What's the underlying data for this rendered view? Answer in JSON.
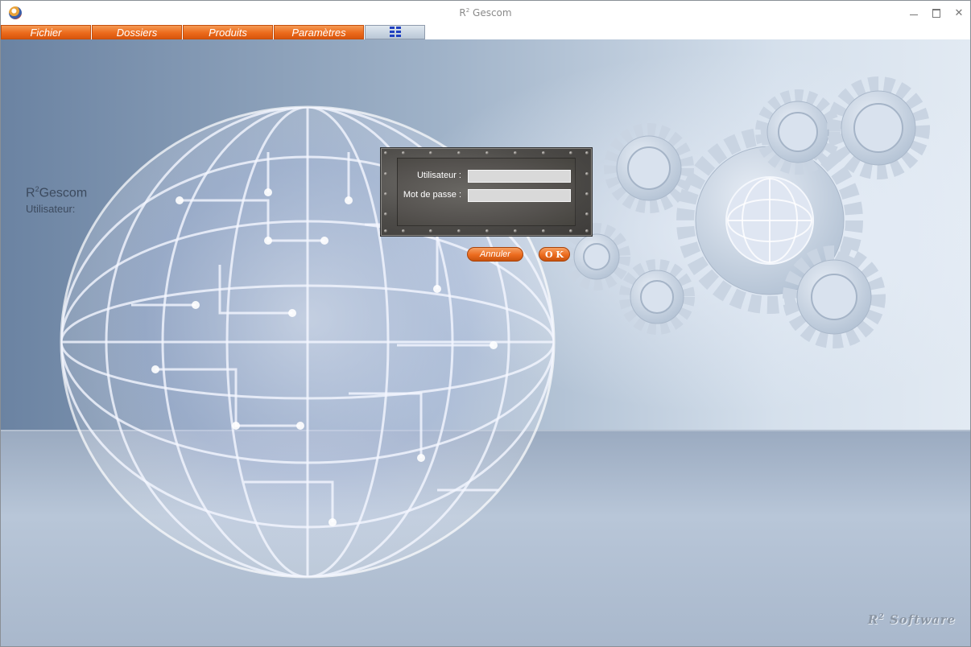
{
  "window": {
    "title_main": "R",
    "title_sup": "2",
    "title_rest": " Gescom",
    "minimize_symbol": "",
    "close_symbol": "✕"
  },
  "menu": {
    "items": [
      {
        "label": "Fichier"
      },
      {
        "label": "Dossiers"
      },
      {
        "label": "Produits"
      },
      {
        "label": "Paramètres"
      }
    ],
    "icon_item": "grid-icon"
  },
  "side": {
    "app_main": "R",
    "app_sup": "2",
    "app_rest": "Gescom",
    "user_label": "Utilisateur:"
  },
  "login": {
    "user_label": "Utilisateur :",
    "user_value": "",
    "password_label": "Mot de passe :",
    "password_value": "",
    "cancel_label": "Annuler",
    "ok_label": "O K"
  },
  "brand": {
    "main": "R",
    "sup": "2",
    "rest": " Software"
  },
  "colors": {
    "menu_orange": "#ec6a1c",
    "dialog_metal": "#55524f",
    "background_blue": "#9fb2c8"
  }
}
